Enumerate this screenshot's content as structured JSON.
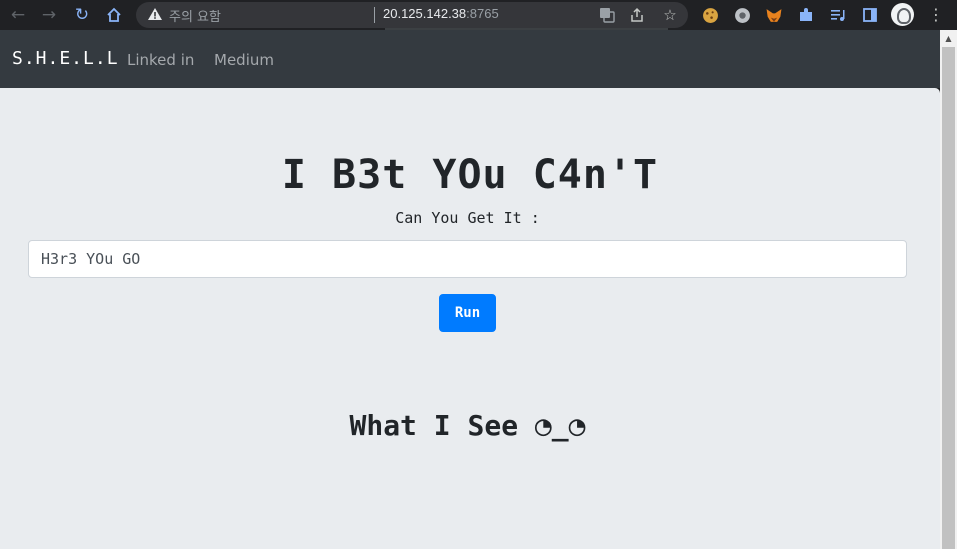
{
  "browser": {
    "security_label": "주의 요함",
    "url_host": "20.125.142.38",
    "url_port": ":8765"
  },
  "navbar": {
    "brand": "S.H.E.L.L",
    "links": [
      "Linked in",
      "Medium"
    ]
  },
  "main": {
    "title": "I B3t YOu C4n'T",
    "prompt_label": "Can You Get It :",
    "input_placeholder": "H3r3 YOu GO",
    "run_label": "Run",
    "output_title": "What I See ◔_◔"
  },
  "colors": {
    "navbar_bg": "#343a40",
    "page_bg": "#e9ecef",
    "button_primary": "#007bff"
  }
}
